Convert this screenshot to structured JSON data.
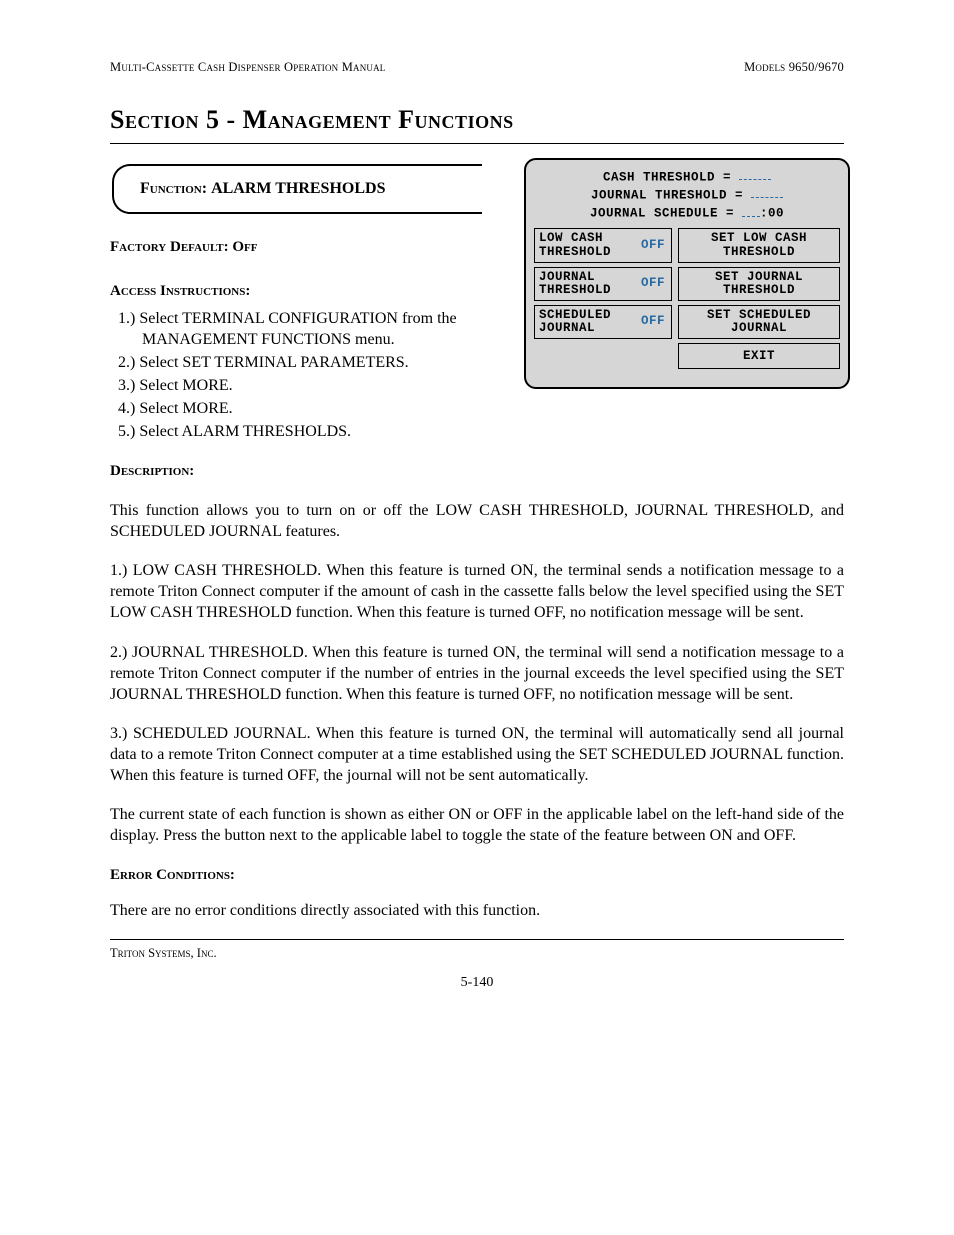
{
  "header": {
    "left": "Multi-Cassette Cash Dispenser Operation Manual",
    "right": "Models 9650/9670"
  },
  "section_title": "Section 5 - Management Functions",
  "function_box": {
    "label_prefix": "Function: ",
    "name": "ALARM THRESHOLDS"
  },
  "screen": {
    "line1_prefix": "CASH THRESHOLD =",
    "line2_prefix": "JOURNAL THRESHOLD =",
    "line3_prefix": "JOURNAL SCHEDULE =",
    "line3_suffix": ":00",
    "rows": [
      {
        "left_label": "LOW CASH\nTHRESHOLD",
        "left_state": "OFF",
        "right_label": "SET LOW CASH\nTHRESHOLD"
      },
      {
        "left_label": "JOURNAL\nTHRESHOLD",
        "left_state": "OFF",
        "right_label": "SET JOURNAL\nTHRESHOLD"
      },
      {
        "left_label": "SCHEDULED\nJOURNAL",
        "left_state": "OFF",
        "right_label": "SET SCHEDULED\nJOURNAL"
      }
    ],
    "exit": "EXIT"
  },
  "factory_default": {
    "label": "Factory Default: ",
    "value": "Off"
  },
  "access_label": "Access Instructions:",
  "access_steps": [
    "1.) Select TERMINAL CONFIGURATION from the MANAGEMENT FUNCTIONS menu.",
    "2.) Select SET TERMINAL PARAMETERS.",
    "3.) Select MORE.",
    "4.) Select MORE.",
    "5.) Select ALARM THRESHOLDS."
  ],
  "description_label": "Description:",
  "description": [
    "This function allows you to turn on or off the LOW CASH THRESHOLD, JOURNAL THRESHOLD, and SCHEDULED JOURNAL features.",
    "1.) LOW CASH THRESHOLD.  When this feature is turned ON, the terminal sends a notification message to a remote Triton Connect computer if the amount of cash in the cassette falls below the level specified using the SET LOW CASH THRESHOLD function. When this feature is turned OFF, no notification message will be sent.",
    "2.) JOURNAL THRESHOLD.  When this feature is turned ON, the terminal will send a notification message to a remote Triton Connect computer if the number of entries in the journal exceeds the level specified using the SET JOURNAL THRESHOLD function. When this feature is turned OFF, no notification message will be sent.",
    "3.) SCHEDULED JOURNAL.  When this feature is turned ON, the terminal will automatically send all journal data to a remote Triton Connect computer at a time established using the SET SCHEDULED JOURNAL function. When this feature is turned OFF, the journal will not be sent automatically.",
    "The current state of  each function is shown as either ON or OFF in the applicable label on the left-hand side of the display. Press the button next to the applicable label to toggle the state of the feature between ON and OFF."
  ],
  "error_label": "Error Conditions:",
  "error_text": "There are no error conditions directly associated with this function.",
  "footer_company": "Triton Systems, Inc.",
  "page_number": "5-140"
}
